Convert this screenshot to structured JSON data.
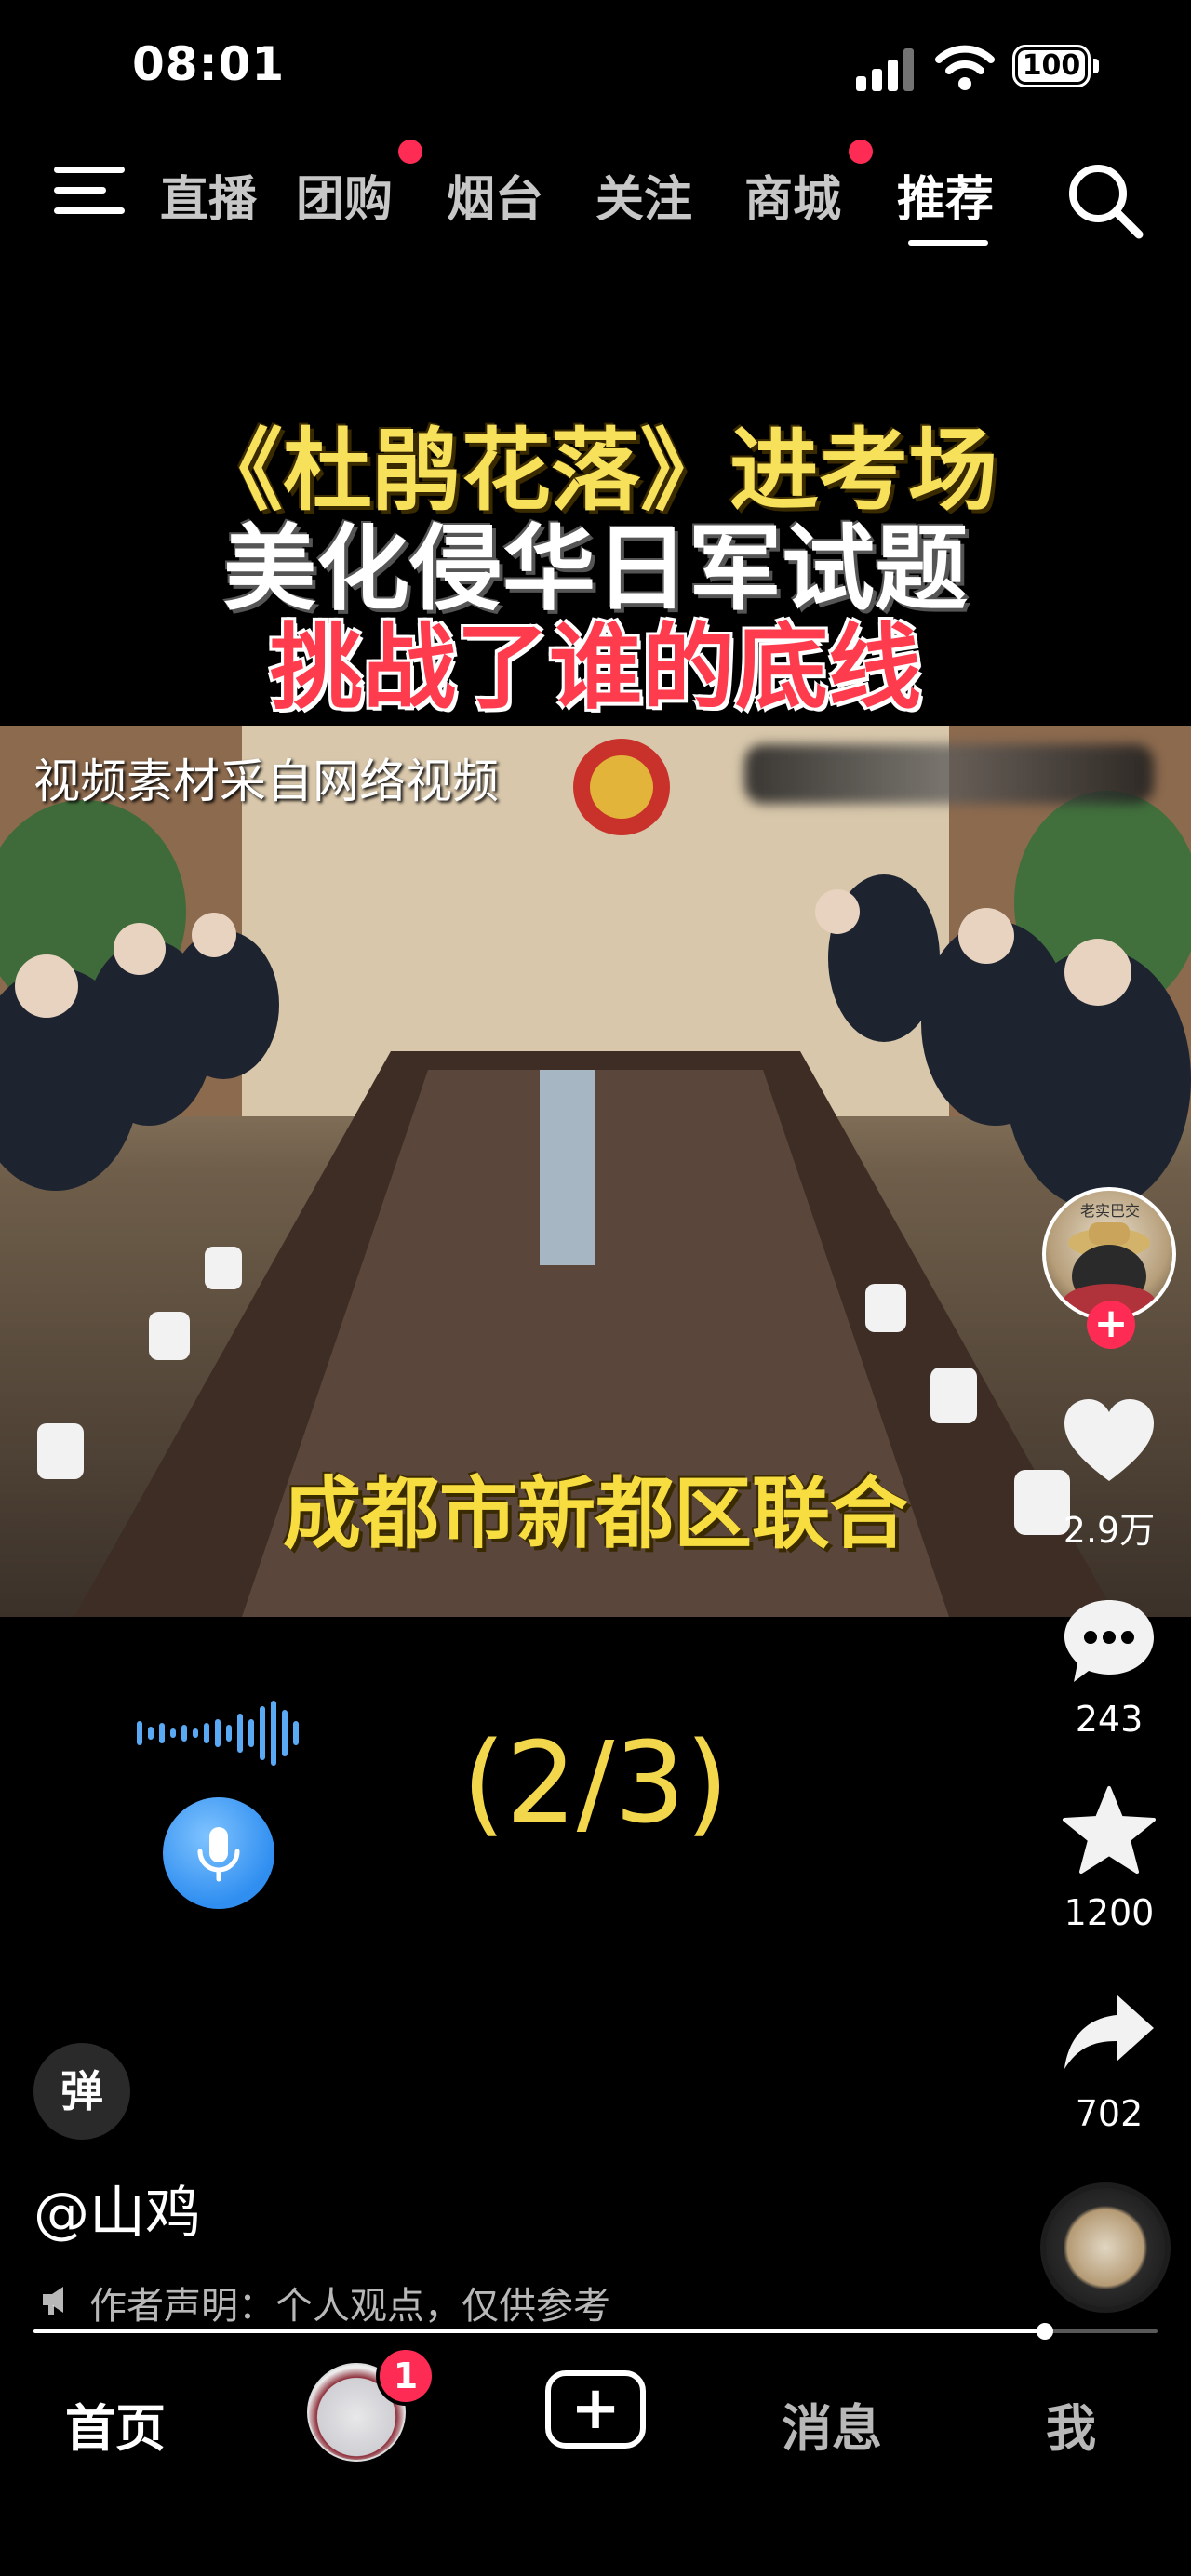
{
  "status_bar": {
    "time": "08:01",
    "battery": "100"
  },
  "nav": {
    "tabs": [
      {
        "label": "直播",
        "has_dot": false
      },
      {
        "label": "团购",
        "has_dot": true
      },
      {
        "label": "烟台",
        "has_dot": false
      },
      {
        "label": "关注",
        "has_dot": false
      },
      {
        "label": "商城",
        "has_dot": true
      },
      {
        "label": "推荐",
        "has_dot": false,
        "active": true
      }
    ]
  },
  "headline": {
    "line1": "《杜鹃花落》进考场",
    "line2": "美化侵华日军试题",
    "line3": "挑战了谁的底线"
  },
  "video": {
    "source_note": "视频素材采自网络视频",
    "subtitle": "成都市新都区联合"
  },
  "part_indicator": "(2/3)",
  "actions": {
    "likes": "2.9万",
    "comments": "243",
    "favorites": "1200",
    "shares": "702"
  },
  "author": {
    "name": "@山鸡",
    "declaration": "作者声明：个人观点，仅供参考",
    "avatar_text": "老实巴交"
  },
  "danmaku_label": "弹",
  "progress": {
    "fraction": 0.9
  },
  "bottom_nav": {
    "home": "首页",
    "friend_badge": "1",
    "create": "+",
    "messages": "消息",
    "me": "我"
  },
  "colors": {
    "accent_red": "#fe2c55",
    "subtitle_yellow": "#f7dd3f",
    "headline_red": "#ff3b4e"
  }
}
